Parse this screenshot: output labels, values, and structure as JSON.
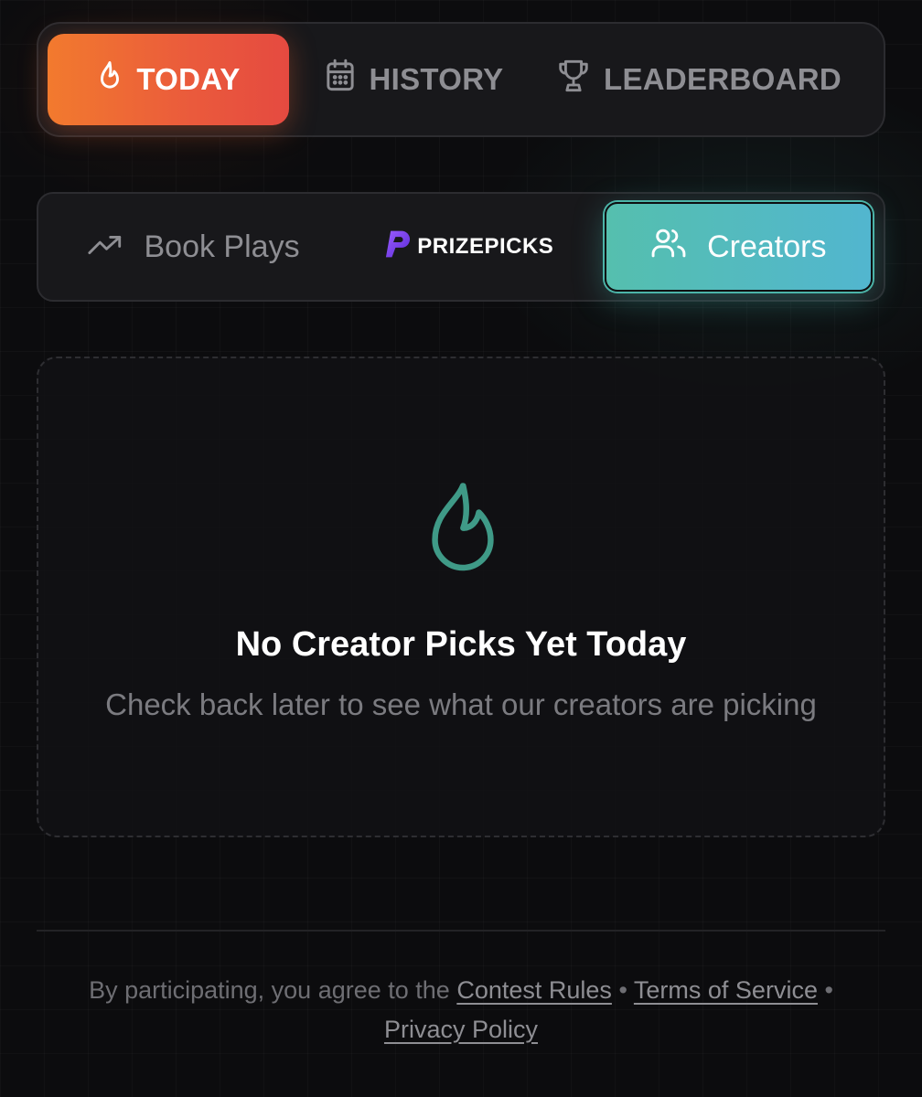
{
  "top_tabs": {
    "today": "TODAY",
    "history": "HISTORY",
    "leaderboard": "LEADERBOARD"
  },
  "sub_tabs": {
    "book_plays": "Book Plays",
    "prizepicks": "PRIZEPICKS",
    "creators": "Creators"
  },
  "empty_state": {
    "title": "No Creator Picks Yet Today",
    "subtitle": "Check back later to see what our creators are picking"
  },
  "footer": {
    "prefix": "By participating, you agree to the",
    "contest_rules": "Contest Rules",
    "separator": "•",
    "terms": "Terms of Service",
    "privacy": "Privacy Policy"
  },
  "colors": {
    "accent_orange": "#f27a2e",
    "accent_red": "#e54a40",
    "accent_teal": "#55bfae",
    "accent_blue": "#52b6cf",
    "flame_teal": "#3f9a87",
    "prizepicks_purple": "#7b3fe4"
  },
  "icons": {
    "today": "flame-icon",
    "history": "calendar-icon",
    "leaderboard": "trophy-icon",
    "book_plays": "trending-up-icon",
    "prizepicks": "prizepicks-logo",
    "creators": "users-icon",
    "empty": "flame-icon"
  }
}
